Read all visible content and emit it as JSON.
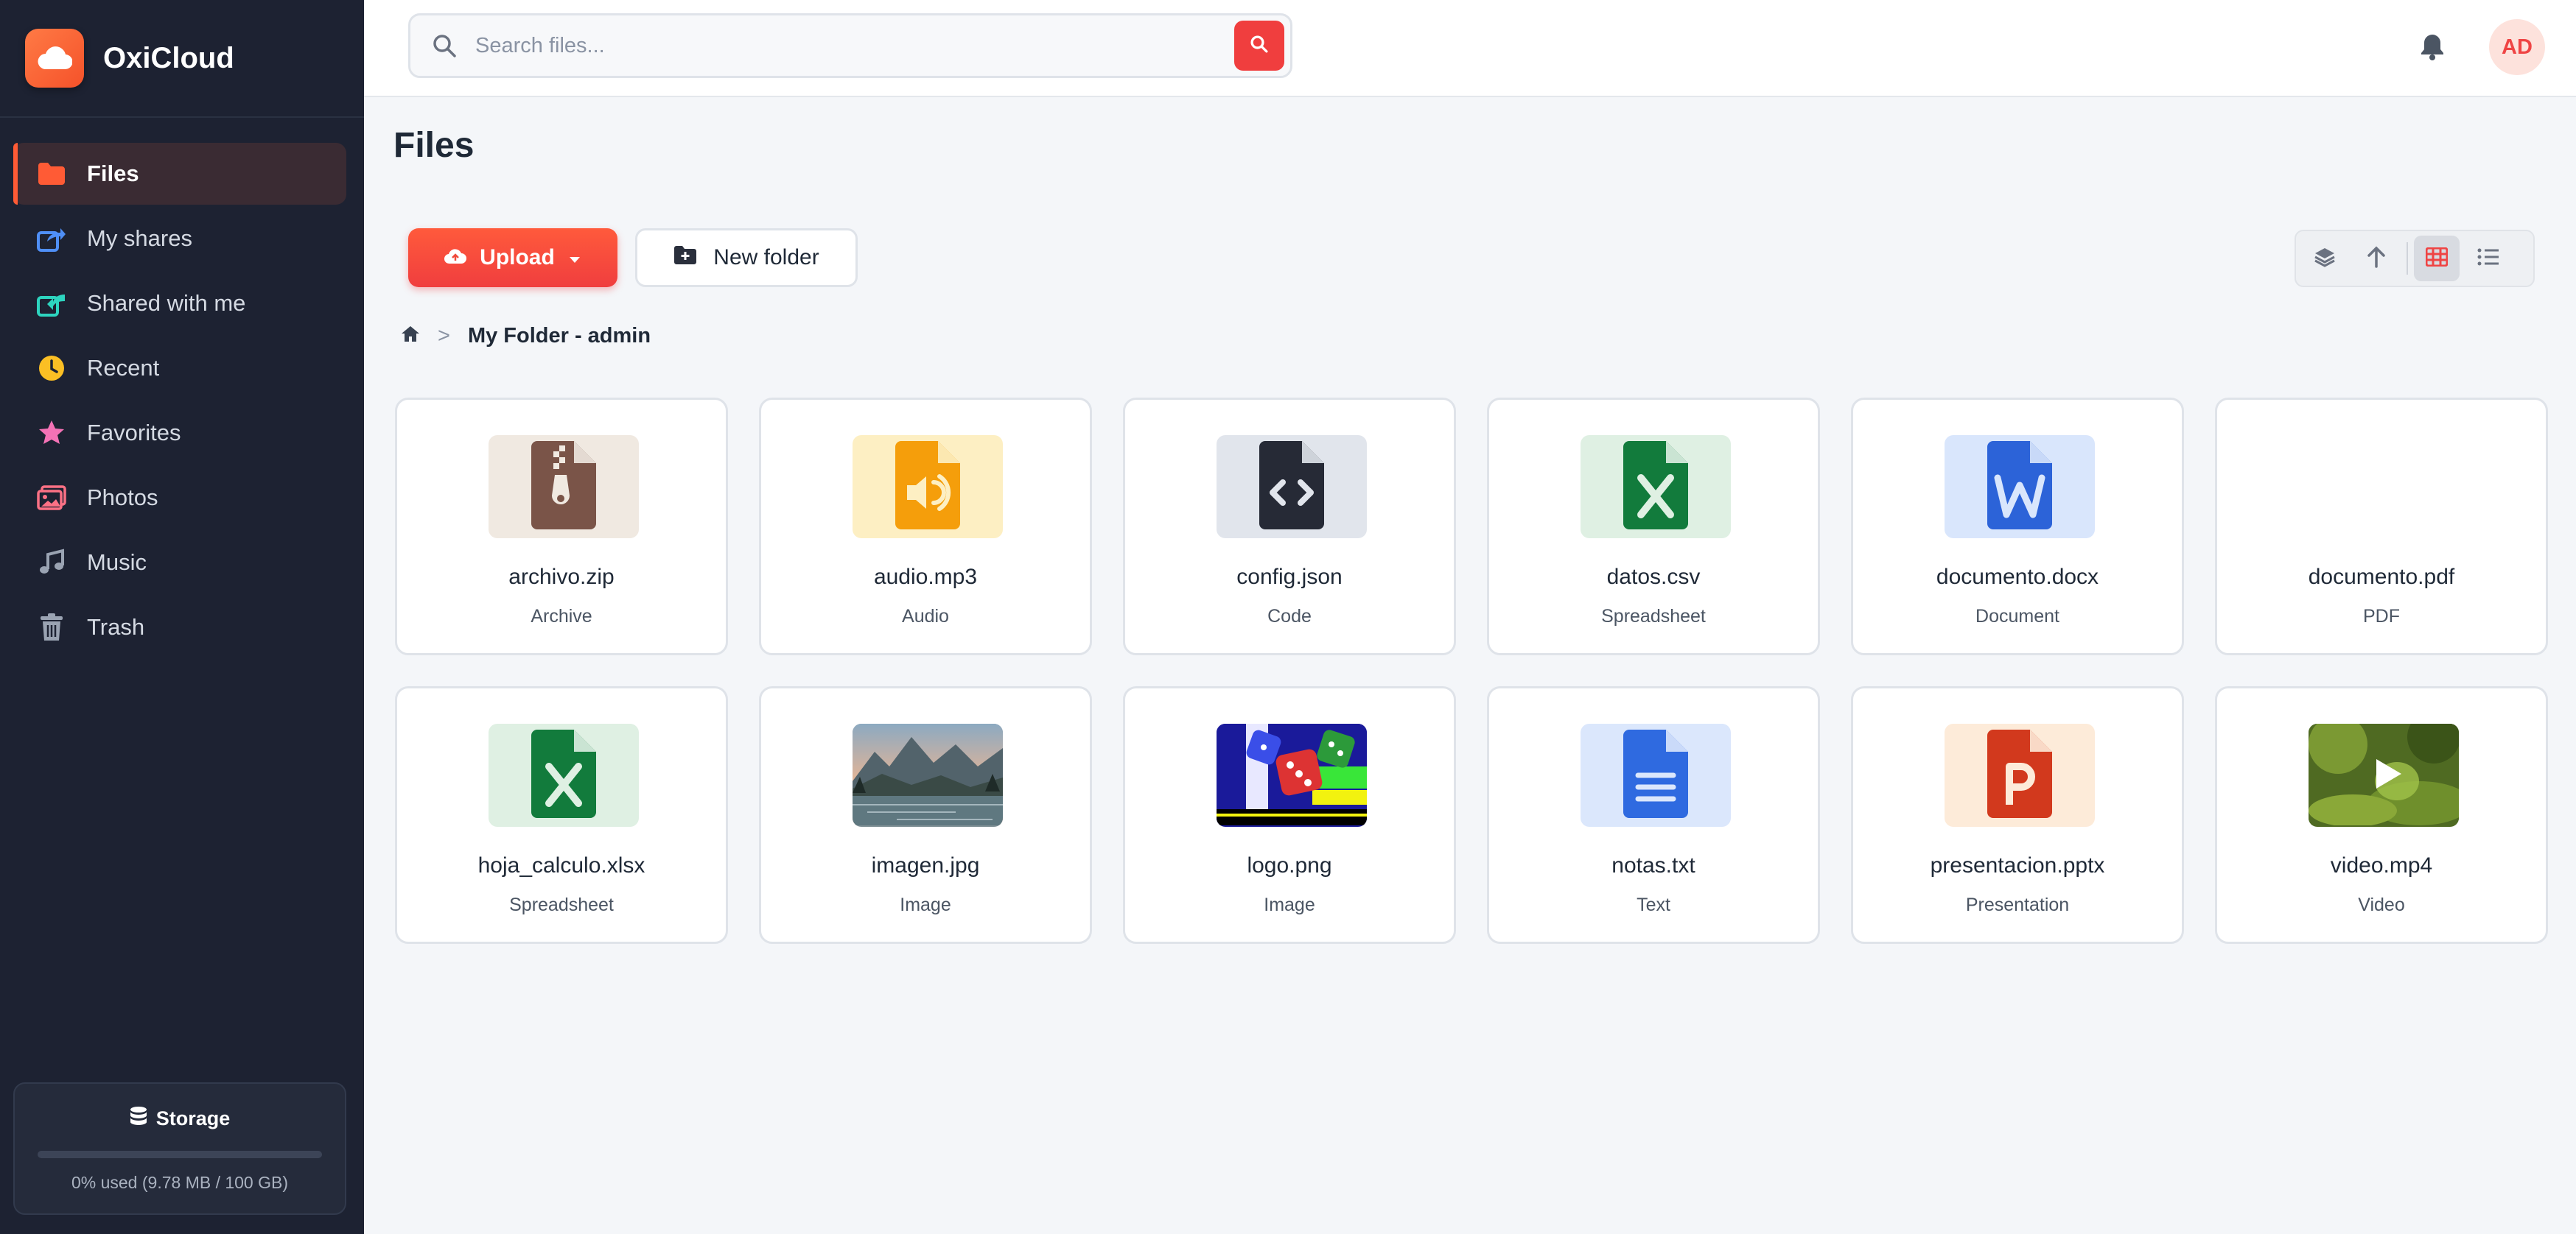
{
  "app": {
    "name": "OxiCloud"
  },
  "sidebar": {
    "items": [
      {
        "label": "Files",
        "icon": "folder-icon",
        "color": "#ff5b35",
        "active": true
      },
      {
        "label": "My shares",
        "icon": "share-out-icon",
        "color": "#4f8ff7"
      },
      {
        "label": "Shared with me",
        "icon": "share-in-icon",
        "color": "#2dd4bf"
      },
      {
        "label": "Recent",
        "icon": "clock-icon",
        "color": "#fbbf24"
      },
      {
        "label": "Favorites",
        "icon": "star-icon",
        "color": "#f472b6"
      },
      {
        "label": "Photos",
        "icon": "image-icon",
        "color": "#fb7185"
      },
      {
        "label": "Music",
        "icon": "music-icon",
        "color": "#9aa3b2"
      },
      {
        "label": "Trash",
        "icon": "trash-icon",
        "color": "#9aa3b2"
      }
    ]
  },
  "storage": {
    "title": "Storage",
    "used_fraction": 0.0,
    "text": "0% used (9.78 MB / 100 GB)"
  },
  "search": {
    "placeholder": "Search files..."
  },
  "header": {
    "avatar_initials": "AD"
  },
  "main": {
    "title": "Files",
    "upload_label": "Upload",
    "new_folder_label": "New folder",
    "breadcrumb": {
      "current": "My Folder - admin",
      "separator": ">"
    }
  },
  "files": [
    {
      "name": "archivo.zip",
      "type": "Archive",
      "icon": "zip-file-icon",
      "bg": "#f0e9e1",
      "fg": "#7a5448"
    },
    {
      "name": "audio.mp3",
      "type": "Audio",
      "icon": "audio-file-icon",
      "bg": "#fdefc3",
      "fg": "#f59e0b"
    },
    {
      "name": "config.json",
      "type": "Code",
      "icon": "code-file-icon",
      "bg": "#e1e5ec",
      "fg": "#262a36"
    },
    {
      "name": "datos.csv",
      "type": "Spreadsheet",
      "icon": "spreadsheet-file-icon",
      "bg": "#dff0e3",
      "fg": "#127b3c"
    },
    {
      "name": "documento.docx",
      "type": "Document",
      "icon": "word-file-icon",
      "bg": "#d9e6fc",
      "fg": "#2c63d8"
    },
    {
      "name": "documento.pdf",
      "type": "PDF",
      "icon": "pdf-file-icon",
      "bg": "#ffffff",
      "fg": "#ffffff"
    },
    {
      "name": "hoja_calculo.xlsx",
      "type": "Spreadsheet",
      "icon": "spreadsheet-file-icon",
      "bg": "#dff0e3",
      "fg": "#127b3c"
    },
    {
      "name": "imagen.jpg",
      "type": "Image",
      "icon": "landscape-photo-thumbnail",
      "bg": "#7d8e94",
      "fg": "#ffffff"
    },
    {
      "name": "logo.png",
      "type": "Image",
      "icon": "dice-image-thumbnail",
      "bg": "#1a1a9a",
      "fg": "#ffffff"
    },
    {
      "name": "notas.txt",
      "type": "Text",
      "icon": "text-file-icon",
      "bg": "#dbe7fc",
      "fg": "#2f6ae0"
    },
    {
      "name": "presentacion.pptx",
      "type": "Presentation",
      "icon": "powerpoint-file-icon",
      "bg": "#fdebd9",
      "fg": "#d2391d"
    },
    {
      "name": "video.mp4",
      "type": "Video",
      "icon": "video-thumbnail",
      "bg": "#4f6a22",
      "fg": "#ffffff"
    }
  ]
}
